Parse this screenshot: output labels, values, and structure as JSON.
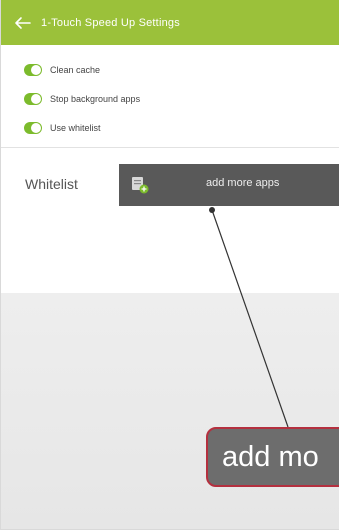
{
  "toolbar": {
    "back_icon": "back-arrow-icon",
    "title": "1-Touch Speed Up Settings",
    "color": "#9bc13a"
  },
  "settings": [
    {
      "label": "Clean cache",
      "enabled": true
    },
    {
      "label": "Stop background apps",
      "enabled": true
    },
    {
      "label": "Use whitelist",
      "enabled": true
    }
  ],
  "whitelist": {
    "label": "Whitelist",
    "add_button_icon": "add-app-icon",
    "add_button_label": "add more apps"
  },
  "callout": {
    "text": "add mo",
    "border_color": "#b4303f"
  }
}
